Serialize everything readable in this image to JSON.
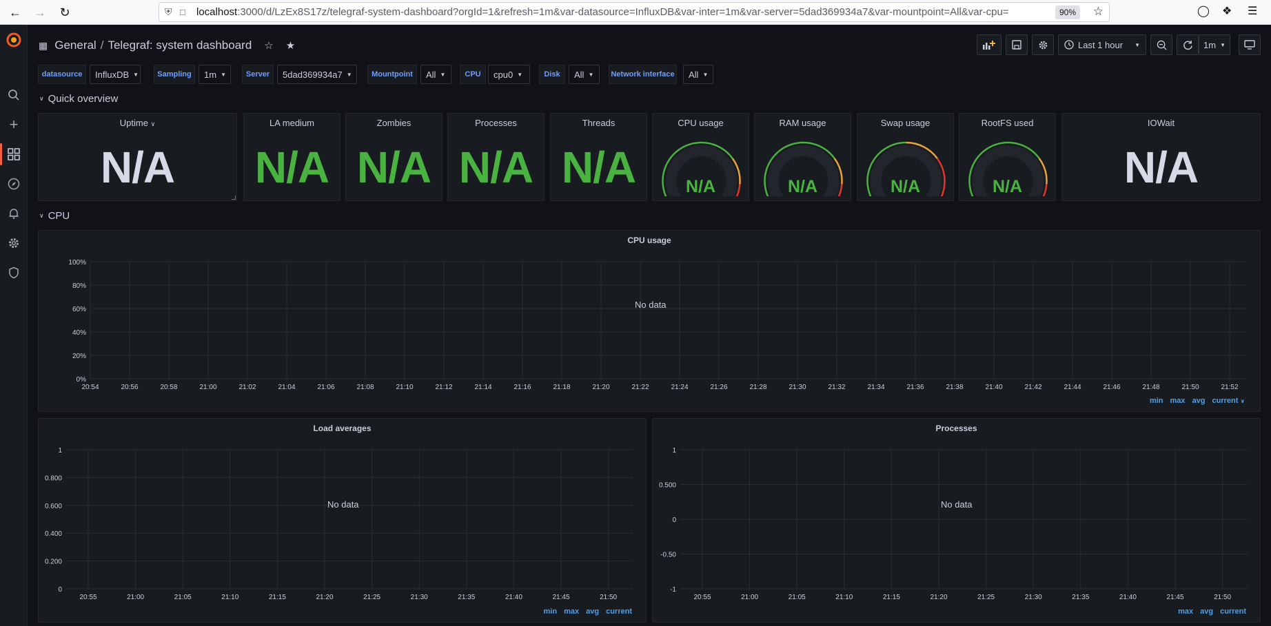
{
  "browser": {
    "url_host": "localhost",
    "url_rest": ":3000/d/LzEx8S17z/telegraf-system-dashboard?orgId=1&refresh=1m&var-datasource=InfluxDB&var-inter=1m&var-server=5dad369934a7&var-mountpoint=All&var-cpu=",
    "zoom": "90%"
  },
  "breadcrumb": {
    "folder": "General",
    "separator": "/",
    "title": "Telegraf: system dashboard"
  },
  "toolbar": {
    "time_range": "Last 1 hour",
    "refresh_interval": "1m"
  },
  "variables": [
    {
      "label": "datasource",
      "value": "InfluxDB"
    },
    {
      "label": "Sampling",
      "value": "1m"
    },
    {
      "label": "Server",
      "value": "5dad369934a7"
    },
    {
      "label": "Mountpoint",
      "value": "All"
    },
    {
      "label": "CPU",
      "value": "cpu0"
    },
    {
      "label": "Disk",
      "value": "All"
    },
    {
      "label": "Network interface",
      "value": "All"
    }
  ],
  "rows": {
    "quick_overview": "Quick overview",
    "cpu": "CPU"
  },
  "stats": [
    {
      "title": "Uptime",
      "value": "N/A",
      "color": "#d8d9e6",
      "kind": "stat",
      "has_menu": true
    },
    {
      "title": "LA medium",
      "value": "N/A",
      "color": "#4ab240",
      "kind": "stat"
    },
    {
      "title": "Zombies",
      "value": "N/A",
      "color": "#4ab240",
      "kind": "stat"
    },
    {
      "title": "Processes",
      "value": "N/A",
      "color": "#4ab240",
      "kind": "stat"
    },
    {
      "title": "Threads",
      "value": "N/A",
      "color": "#4ab240",
      "kind": "stat"
    },
    {
      "title": "CPU usage",
      "value": "N/A",
      "kind": "gauge"
    },
    {
      "title": "RAM usage",
      "value": "N/A",
      "kind": "gauge"
    },
    {
      "title": "Swap usage",
      "value": "N/A",
      "kind": "gauge"
    },
    {
      "title": "RootFS used",
      "value": "N/A",
      "kind": "gauge"
    },
    {
      "title": "IOWait",
      "value": "N/A",
      "color": "#d8d9e6",
      "kind": "stat"
    }
  ],
  "chart_data": [
    {
      "type": "line",
      "title": "CPU usage",
      "no_data": "No data",
      "y_ticks": [
        "100%",
        "80%",
        "60%",
        "40%",
        "20%",
        "0%"
      ],
      "x": [
        "20:54",
        "20:56",
        "20:58",
        "21:00",
        "21:02",
        "21:04",
        "21:06",
        "21:08",
        "21:10",
        "21:12",
        "21:14",
        "21:16",
        "21:18",
        "21:20",
        "21:22",
        "21:24",
        "21:26",
        "21:28",
        "21:30",
        "21:32",
        "21:34",
        "21:36",
        "21:38",
        "21:40",
        "21:42",
        "21:44",
        "21:46",
        "21:48",
        "21:50",
        "21:52"
      ],
      "legend": [
        "min",
        "max",
        "avg",
        "current"
      ],
      "series": []
    },
    {
      "type": "line",
      "title": "Load averages",
      "no_data": "No data",
      "y_ticks": [
        "1",
        "0.800",
        "0.600",
        "0.400",
        "0.200",
        "0"
      ],
      "x": [
        "20:55",
        "21:00",
        "21:05",
        "21:10",
        "21:15",
        "21:20",
        "21:25",
        "21:30",
        "21:35",
        "21:40",
        "21:45",
        "21:50"
      ],
      "legend": [
        "min",
        "max",
        "avg",
        "current"
      ],
      "series": []
    },
    {
      "type": "line",
      "title": "Processes",
      "no_data": "No data",
      "y_ticks": [
        "1",
        "0.500",
        "0",
        "-0.50",
        "-1"
      ],
      "x": [
        "20:55",
        "21:00",
        "21:05",
        "21:10",
        "21:15",
        "21:20",
        "21:25",
        "21:30",
        "21:35",
        "21:40",
        "21:45",
        "21:50"
      ],
      "legend": [
        "max",
        "avg",
        "current"
      ],
      "series": []
    }
  ]
}
